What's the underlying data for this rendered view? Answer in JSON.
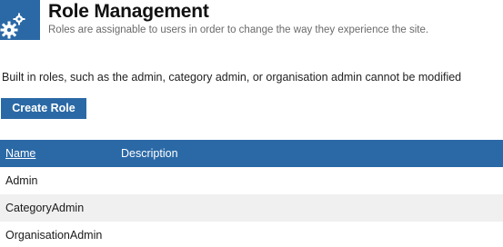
{
  "header": {
    "title": "Role Management",
    "subtitle": "Roles are assignable to users in order to change the way they experience the site.",
    "icon": "gears-icon"
  },
  "notice": "Built in roles, such as the admin, category admin, or organisation admin cannot be modified",
  "toolbar": {
    "create_label": "Create Role"
  },
  "table": {
    "columns": {
      "name": "Name",
      "description": "Description"
    },
    "rows": [
      {
        "name": "Admin",
        "description": ""
      },
      {
        "name": "CategoryAdmin",
        "description": ""
      },
      {
        "name": "OrganisationAdmin",
        "description": ""
      }
    ]
  },
  "colors": {
    "accent": "#2b69a6",
    "row_alt": "#f0f0f0"
  }
}
